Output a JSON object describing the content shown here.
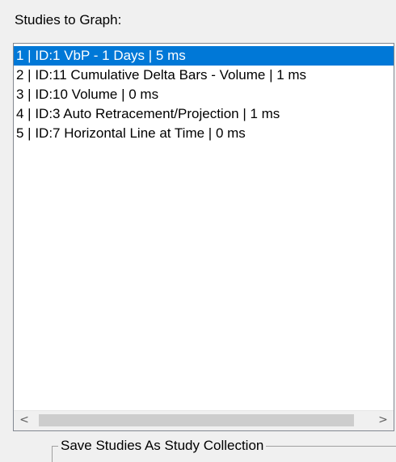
{
  "section_label": "Studies to Graph:",
  "studies_list": {
    "items": [
      {
        "label": "1 | ID:1  VbP - 1 Days | 5 ms",
        "selected": true
      },
      {
        "label": "2 | ID:11  Cumulative Delta Bars - Volume | 1 ms",
        "selected": false
      },
      {
        "label": "3 | ID:10  Volume | 0 ms",
        "selected": false
      },
      {
        "label": "4 | ID:3  Auto Retracement/Projection | 1 ms",
        "selected": false
      },
      {
        "label": "5 | ID:7  Horizontal Line at Time | 0 ms",
        "selected": false
      }
    ]
  },
  "scrollbar": {
    "left_arrow": "<",
    "right_arrow": ">"
  },
  "collection_group": {
    "title": "Save Studies As Study Collection"
  },
  "colors": {
    "selection": "#0078d7",
    "background": "#f0f0f0"
  }
}
